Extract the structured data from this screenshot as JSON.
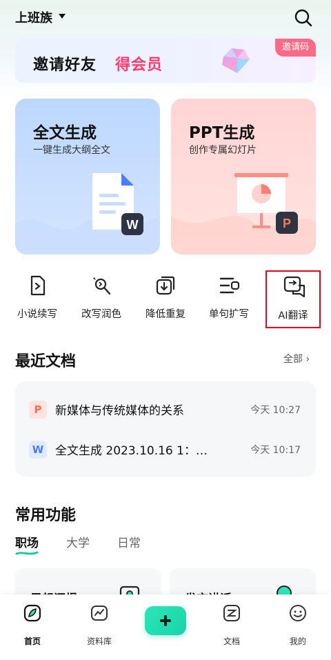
{
  "header": {
    "title": "上班族"
  },
  "banner": {
    "text_black": "邀请好友",
    "text_red": "得会员",
    "invite_label": "邀请码"
  },
  "cards": [
    {
      "title": "全文生成",
      "subtitle": "一键生成大纲全文",
      "badge": "W"
    },
    {
      "title": "PPT生成",
      "subtitle": "创作专属幻灯片",
      "badge": "P"
    }
  ],
  "tools": [
    {
      "label": "小说续写",
      "icon": "novel-continue-icon"
    },
    {
      "label": "改写润色",
      "icon": "rewrite-polish-icon"
    },
    {
      "label": "降低重复",
      "icon": "reduce-duplicate-icon"
    },
    {
      "label": "单句扩写",
      "icon": "sentence-expand-icon"
    },
    {
      "label": "AI翻译",
      "icon": "ai-translate-icon",
      "highlighted": true
    }
  ],
  "recent": {
    "title": "最近文档",
    "all_label": "全部",
    "docs": [
      {
        "badge": "P",
        "name": "新媒体与传统媒体的关系",
        "time": "今天 10:27",
        "badge_color": "#ff6a5c",
        "badge_bg": "#ffe3df"
      },
      {
        "badge": "W",
        "name": "全文生成 2023.10.16 1：…",
        "time": "今天 10:17",
        "badge_color": "#4a7cff",
        "badge_bg": "#e2ebff"
      }
    ]
  },
  "common": {
    "title": "常用功能",
    "tabs": [
      "职场",
      "大学",
      "日常"
    ],
    "active_tab": "职场",
    "cards": [
      {
        "title": "思想汇报"
      },
      {
        "title": "发言讲话"
      }
    ]
  },
  "nav": {
    "items": [
      {
        "label": "首页",
        "icon": "home-icon",
        "active": true
      },
      {
        "label": "资料库",
        "icon": "library-icon"
      },
      {
        "label": "文档",
        "icon": "document-icon"
      },
      {
        "label": "我的",
        "icon": "profile-icon"
      }
    ]
  },
  "colors": {
    "accent_green": "#18d4a8",
    "invite_pink": "#ff6a86",
    "highlight_red": "#e00022"
  }
}
